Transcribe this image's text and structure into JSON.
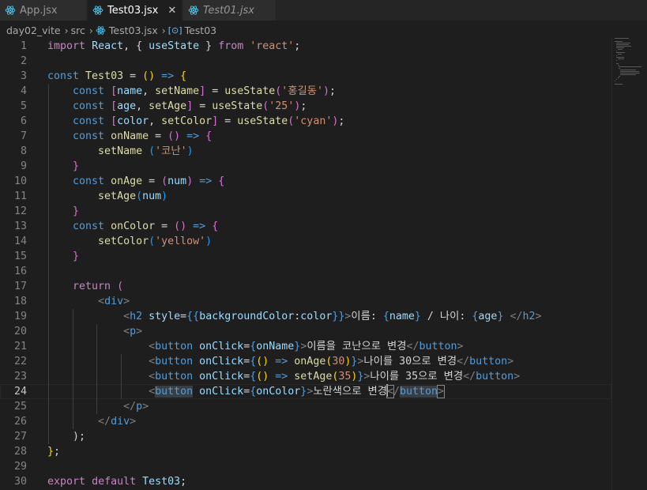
{
  "tabs": [
    {
      "label": "App.jsx",
      "active": false,
      "italic": false
    },
    {
      "label": "Test03.jsx",
      "active": true,
      "italic": false
    },
    {
      "label": "Test01.jsx",
      "active": false,
      "italic": true
    }
  ],
  "tab_close_glyph": "✕",
  "breadcrumb": {
    "folder": "day02_vite",
    "subfolder": "src",
    "file": "Test03.jsx",
    "symbol_glyph": "[⊙]",
    "symbol": "Test03"
  },
  "current_line": 24,
  "lines": [
    {
      "n": "1",
      "t": [
        [
          "import",
          "c"
        ],
        [
          " ",
          "w"
        ],
        [
          "React",
          "v"
        ],
        [
          ", { ",
          "w"
        ],
        [
          "useState",
          "v"
        ],
        [
          " } ",
          "w"
        ],
        [
          "from",
          "c"
        ],
        [
          " ",
          "w"
        ],
        [
          "'react'",
          "s"
        ],
        [
          ";",
          "w"
        ]
      ]
    },
    {
      "n": "2",
      "t": []
    },
    {
      "n": "3",
      "t": [
        [
          "const",
          "k"
        ],
        [
          " ",
          "w"
        ],
        [
          "Test03",
          "f"
        ],
        [
          " = ",
          "w"
        ],
        [
          "()",
          "y"
        ],
        [
          " => ",
          "k"
        ],
        [
          "{",
          "y"
        ]
      ]
    },
    {
      "n": "4",
      "t": [
        [
          "    ",
          "w"
        ],
        [
          "const",
          "k"
        ],
        [
          " ",
          "w"
        ],
        [
          "[",
          "p"
        ],
        [
          "name",
          "v"
        ],
        [
          ", ",
          "w"
        ],
        [
          "setName",
          "f"
        ],
        [
          "]",
          "p"
        ],
        [
          " = ",
          "w"
        ],
        [
          "useState",
          "f"
        ],
        [
          "(",
          "p"
        ],
        [
          "'홍길동'",
          "s"
        ],
        [
          ")",
          "p"
        ],
        [
          ";",
          "w"
        ]
      ]
    },
    {
      "n": "5",
      "t": [
        [
          "    ",
          "w"
        ],
        [
          "const",
          "k"
        ],
        [
          " ",
          "w"
        ],
        [
          "[",
          "p"
        ],
        [
          "age",
          "v"
        ],
        [
          ", ",
          "w"
        ],
        [
          "setAge",
          "f"
        ],
        [
          "]",
          "p"
        ],
        [
          " = ",
          "w"
        ],
        [
          "useState",
          "f"
        ],
        [
          "(",
          "p"
        ],
        [
          "'25'",
          "s"
        ],
        [
          ")",
          "p"
        ],
        [
          ";",
          "w"
        ]
      ]
    },
    {
      "n": "6",
      "t": [
        [
          "    ",
          "w"
        ],
        [
          "const",
          "k"
        ],
        [
          " ",
          "w"
        ],
        [
          "[",
          "p"
        ],
        [
          "color",
          "v"
        ],
        [
          ", ",
          "w"
        ],
        [
          "setColor",
          "f"
        ],
        [
          "]",
          "p"
        ],
        [
          " = ",
          "w"
        ],
        [
          "useState",
          "f"
        ],
        [
          "(",
          "p"
        ],
        [
          "'cyan'",
          "s"
        ],
        [
          ")",
          "p"
        ],
        [
          ";",
          "w"
        ]
      ]
    },
    {
      "n": "7",
      "t": [
        [
          "    ",
          "w"
        ],
        [
          "const",
          "k"
        ],
        [
          " ",
          "w"
        ],
        [
          "onName",
          "f"
        ],
        [
          " = ",
          "w"
        ],
        [
          "()",
          "p"
        ],
        [
          " => ",
          "k"
        ],
        [
          "{",
          "p"
        ]
      ]
    },
    {
      "n": "8",
      "t": [
        [
          "        ",
          "w"
        ],
        [
          "setName",
          "f"
        ],
        [
          " ",
          "w"
        ],
        [
          "(",
          "b"
        ],
        [
          "'코난'",
          "s"
        ],
        [
          ")",
          "b"
        ]
      ]
    },
    {
      "n": "9",
      "t": [
        [
          "    ",
          "w"
        ],
        [
          "}",
          "p"
        ]
      ]
    },
    {
      "n": "10",
      "t": [
        [
          "    ",
          "w"
        ],
        [
          "const",
          "k"
        ],
        [
          " ",
          "w"
        ],
        [
          "onAge",
          "f"
        ],
        [
          " = ",
          "w"
        ],
        [
          "(",
          "p"
        ],
        [
          "num",
          "v"
        ],
        [
          ")",
          "p"
        ],
        [
          " => ",
          "k"
        ],
        [
          "{",
          "p"
        ]
      ]
    },
    {
      "n": "11",
      "t": [
        [
          "        ",
          "w"
        ],
        [
          "setAge",
          "f"
        ],
        [
          "(",
          "b"
        ],
        [
          "num",
          "v"
        ],
        [
          ")",
          "b"
        ]
      ]
    },
    {
      "n": "12",
      "t": [
        [
          "    ",
          "w"
        ],
        [
          "}",
          "p"
        ]
      ]
    },
    {
      "n": "13",
      "t": [
        [
          "    ",
          "w"
        ],
        [
          "const",
          "k"
        ],
        [
          " ",
          "w"
        ],
        [
          "onColor",
          "f"
        ],
        [
          " = ",
          "w"
        ],
        [
          "()",
          "p"
        ],
        [
          " => ",
          "k"
        ],
        [
          "{",
          "p"
        ]
      ]
    },
    {
      "n": "14",
      "t": [
        [
          "        ",
          "w"
        ],
        [
          "setColor",
          "f"
        ],
        [
          "(",
          "b"
        ],
        [
          "'yellow'",
          "s"
        ],
        [
          ")",
          "b"
        ]
      ]
    },
    {
      "n": "15",
      "t": [
        [
          "    ",
          "w"
        ],
        [
          "}",
          "p"
        ]
      ]
    },
    {
      "n": "16",
      "t": []
    },
    {
      "n": "17",
      "t": [
        [
          "    ",
          "w"
        ],
        [
          "return",
          "c"
        ],
        [
          " ",
          "w"
        ],
        [
          "(",
          "p"
        ]
      ]
    },
    {
      "n": "18",
      "t": [
        [
          "        ",
          "w"
        ],
        [
          "<",
          "g"
        ],
        [
          "div",
          "k"
        ],
        [
          ">",
          "g"
        ]
      ]
    },
    {
      "n": "19",
      "t": [
        [
          "            ",
          "w"
        ],
        [
          "<",
          "g"
        ],
        [
          "h2",
          "k"
        ],
        [
          " ",
          "w"
        ],
        [
          "style",
          "v"
        ],
        [
          "=",
          "w"
        ],
        [
          "{{",
          "k"
        ],
        [
          "backgroundColor",
          "v"
        ],
        [
          ":",
          "w"
        ],
        [
          "color",
          "v"
        ],
        [
          "}}",
          "k"
        ],
        [
          ">",
          "g"
        ],
        [
          "이름: ",
          "w"
        ],
        [
          "{",
          "k"
        ],
        [
          "name",
          "v"
        ],
        [
          "}",
          "k"
        ],
        [
          " / 나이: ",
          "w"
        ],
        [
          "{",
          "k"
        ],
        [
          "age",
          "v"
        ],
        [
          "}",
          "k"
        ],
        [
          " ",
          "w"
        ],
        [
          "</",
          "g"
        ],
        [
          "h2",
          "k"
        ],
        [
          ">",
          "g"
        ]
      ]
    },
    {
      "n": "20",
      "t": [
        [
          "            ",
          "w"
        ],
        [
          "<",
          "g"
        ],
        [
          "p",
          "k"
        ],
        [
          ">",
          "g"
        ]
      ]
    },
    {
      "n": "21",
      "t": [
        [
          "                ",
          "w"
        ],
        [
          "<",
          "g"
        ],
        [
          "button",
          "k"
        ],
        [
          " ",
          "w"
        ],
        [
          "onClick",
          "v"
        ],
        [
          "=",
          "w"
        ],
        [
          "{",
          "k"
        ],
        [
          "onName",
          "v"
        ],
        [
          "}",
          "k"
        ],
        [
          ">",
          "g"
        ],
        [
          "이름을 코난으로 변경",
          "w"
        ],
        [
          "</",
          "g"
        ],
        [
          "button",
          "k"
        ],
        [
          ">",
          "g"
        ]
      ]
    },
    {
      "n": "22",
      "t": [
        [
          "                ",
          "w"
        ],
        [
          "<",
          "g"
        ],
        [
          "button",
          "k"
        ],
        [
          " ",
          "w"
        ],
        [
          "onClick",
          "v"
        ],
        [
          "=",
          "w"
        ],
        [
          "{",
          "k"
        ],
        [
          "()",
          "y"
        ],
        [
          " => ",
          "k"
        ],
        [
          "onAge",
          "f"
        ],
        [
          "(",
          "y"
        ],
        [
          "30",
          "s"
        ],
        [
          ")",
          "y"
        ],
        [
          "}",
          "k"
        ],
        [
          ">",
          "g"
        ],
        [
          "나이를 30으로 변경",
          "w"
        ],
        [
          "</",
          "g"
        ],
        [
          "button",
          "k"
        ],
        [
          ">",
          "g"
        ]
      ]
    },
    {
      "n": "23",
      "t": [
        [
          "                ",
          "w"
        ],
        [
          "<",
          "g"
        ],
        [
          "button",
          "k"
        ],
        [
          " ",
          "w"
        ],
        [
          "onClick",
          "v"
        ],
        [
          "=",
          "w"
        ],
        [
          "{",
          "k"
        ],
        [
          "()",
          "y"
        ],
        [
          " => ",
          "k"
        ],
        [
          "setAge",
          "f"
        ],
        [
          "(",
          "y"
        ],
        [
          "35",
          "s"
        ],
        [
          ")",
          "y"
        ],
        [
          "}",
          "k"
        ],
        [
          ">",
          "g"
        ],
        [
          "나이를 35으로 변경",
          "w"
        ],
        [
          "</",
          "g"
        ],
        [
          "button",
          "k"
        ],
        [
          ">",
          "g"
        ]
      ]
    },
    {
      "n": "24",
      "t": [
        [
          "                ",
          "w"
        ],
        [
          "<",
          "g"
        ],
        [
          "button",
          "k hl"
        ],
        [
          " ",
          "w"
        ],
        [
          "onClick",
          "v"
        ],
        [
          "=",
          "w"
        ],
        [
          "{",
          "k"
        ],
        [
          "onColor",
          "v"
        ],
        [
          "}",
          "k"
        ],
        [
          ">",
          "g"
        ],
        [
          "노란색으로 변경",
          "w"
        ],
        [
          "|",
          "cursor"
        ],
        [
          "<",
          "g bm"
        ],
        [
          "/",
          "g"
        ],
        [
          "button",
          "k hl"
        ],
        [
          ">",
          "g bm"
        ]
      ]
    },
    {
      "n": "25",
      "t": [
        [
          "            ",
          "w"
        ],
        [
          "</",
          "g"
        ],
        [
          "p",
          "k"
        ],
        [
          ">",
          "g"
        ]
      ]
    },
    {
      "n": "26",
      "t": [
        [
          "        ",
          "w"
        ],
        [
          "</",
          "g"
        ],
        [
          "div",
          "k"
        ],
        [
          ">",
          "g"
        ]
      ]
    },
    {
      "n": "27",
      "t": [
        [
          "    ",
          "w"
        ],
        [
          ");",
          "w"
        ]
      ]
    },
    {
      "n": "28",
      "t": [
        [
          "}",
          "y"
        ],
        [
          ";",
          "w"
        ]
      ]
    },
    {
      "n": "29",
      "t": []
    },
    {
      "n": "30",
      "t": [
        [
          "export",
          "c"
        ],
        [
          " ",
          "w"
        ],
        [
          "default",
          "c"
        ],
        [
          " ",
          "w"
        ],
        [
          "Test03",
          "v"
        ],
        [
          ";",
          "w"
        ]
      ]
    }
  ]
}
